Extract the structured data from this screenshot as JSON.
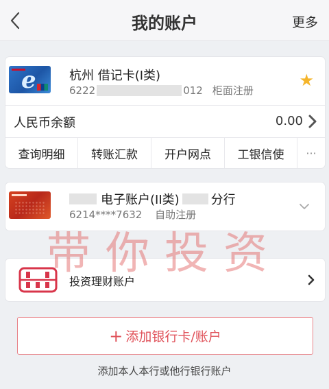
{
  "header": {
    "title": "我的账户",
    "more_label": "更多"
  },
  "debit_card": {
    "name": "杭州 借记卡(I类)",
    "number_prefix": "6222",
    "number_suffix": "012",
    "register_type": "柜面注册",
    "balance_label": "人民币余额",
    "balance_value": "0.00",
    "actions": [
      "查询明细",
      "转账汇款",
      "开户网点",
      "工银信使"
    ],
    "more_actions": "···"
  },
  "e_account": {
    "name_middle": "电子账户(II类)",
    "name_suffix": "分行",
    "number": "6214****7632",
    "register_type": "自助注册"
  },
  "investment": {
    "label": "投资理财账户"
  },
  "add_button": {
    "plus": "+",
    "label": "添加银行卡/账户"
  },
  "footer_note": "添加本人本行或他行银行账户",
  "watermark": "带你投资",
  "colors": {
    "accent": "#e0525a",
    "star": "#f5b52b"
  }
}
